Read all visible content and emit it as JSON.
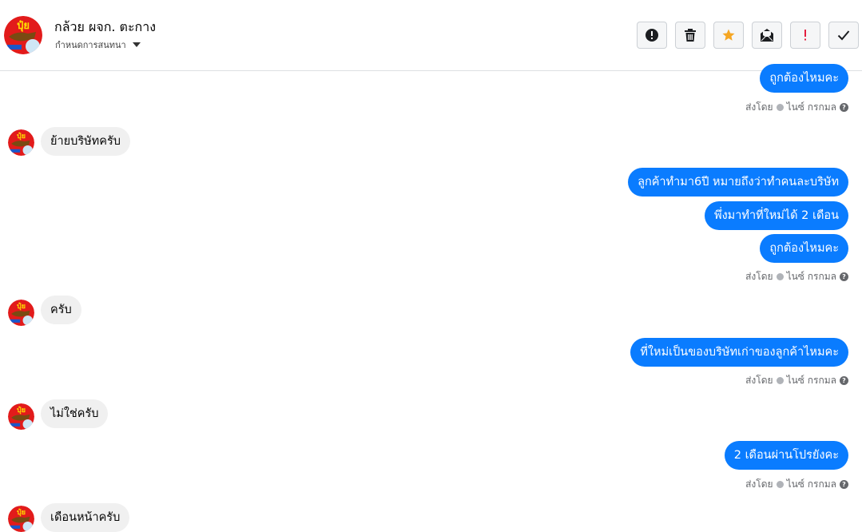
{
  "header": {
    "contact_name": "กล้วย ผจก. ตะกาง",
    "assign_label": "กำหนดการสนทนา"
  },
  "actions": [
    {
      "name": "report-spam-button",
      "icon": "exclamation-circle-icon"
    },
    {
      "name": "delete-button",
      "icon": "trash-icon"
    },
    {
      "name": "star-button",
      "icon": "star-icon"
    },
    {
      "name": "mark-unread-button",
      "icon": "envelope-open-icon"
    },
    {
      "name": "follow-up-button",
      "icon": "exclamation-icon"
    },
    {
      "name": "mark-done-button",
      "icon": "check-icon"
    }
  ],
  "colors": {
    "outgoing": "#0a7cff",
    "incoming": "#f0f0f0",
    "star": "#f5a623",
    "alert": "#e41e3f"
  },
  "meta": {
    "sent_by": "ส่งโดย",
    "sender": "ไนซ์ กรกมล"
  },
  "messages": {
    "m1": "ถูกต้องไหมคะ",
    "m2": "ย้ายบริษัทครับ",
    "m3": "ลูกค้าทำมา6ปี หมายถึงว่าทำคนละบริษัท",
    "m4": "พึ่งมาทำที่ใหม่ได้ 2 เดือน",
    "m5": "ถูกต้องไหมคะ",
    "m6": "ครับ",
    "m7": "ที่ใหม่เป็นของบริษัทเก่าของลูกค้าไหมคะ",
    "m8": "ไม่ใช่ครับ",
    "m9": "2 เดือนผ่านโปรยังคะ",
    "m10": "เดือนหน้าครับ"
  },
  "avatar": {
    "text": "ปุ๋ย",
    "sub": "ปลานิล"
  }
}
